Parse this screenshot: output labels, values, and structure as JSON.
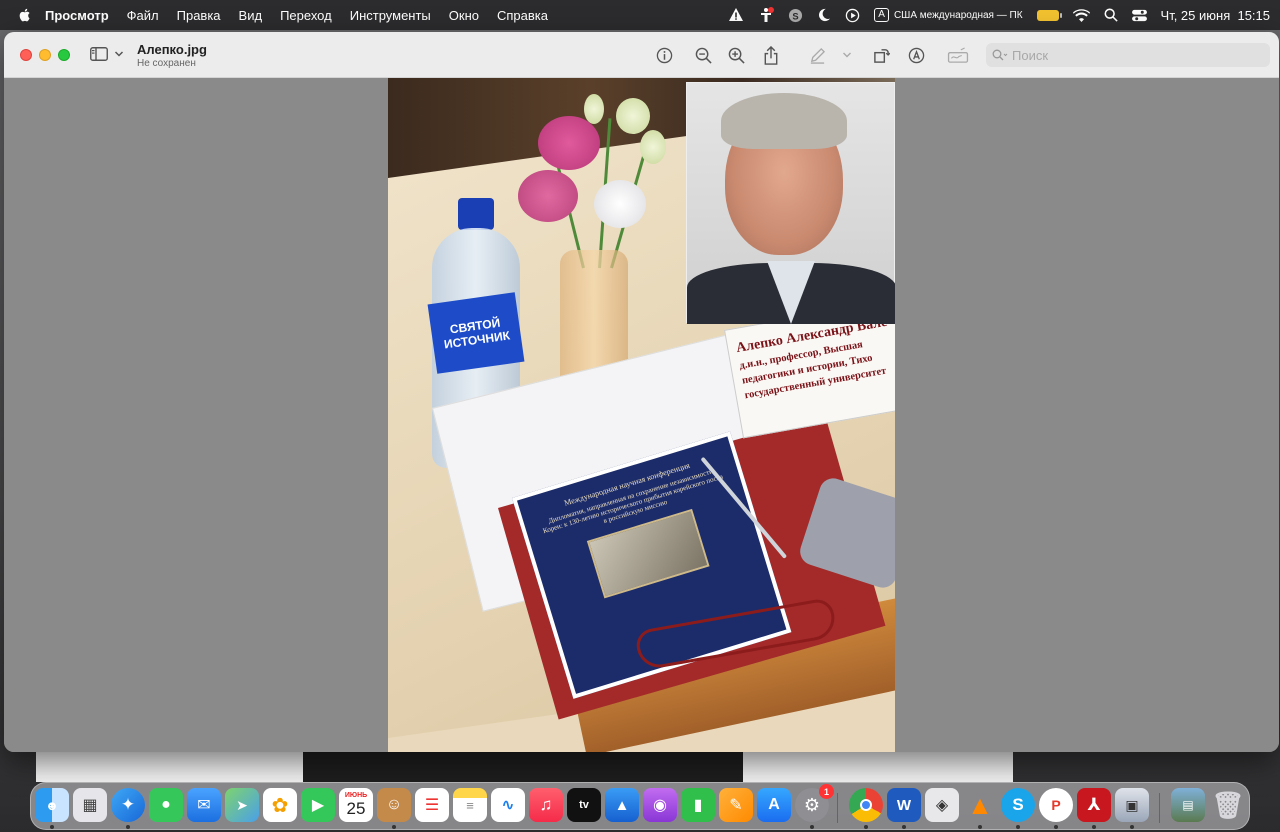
{
  "menubar": {
    "app_name": "Просмотр",
    "items": [
      "Файл",
      "Правка",
      "Вид",
      "Переход",
      "Инструменты",
      "Окно",
      "Справка"
    ],
    "input_source_key": "A",
    "input_source": "США международная — ПК",
    "datetime": "Чт, 25 июня  15:15",
    "icons": [
      "apple-icon",
      "warning-icon",
      "accessibility-icon",
      "skype-icon",
      "moon-icon",
      "play-icon",
      "battery-icon",
      "wifi-icon",
      "search-icon",
      "control-center-icon"
    ]
  },
  "window": {
    "title": "Алепко.jpg",
    "subtitle": "Не сохранен",
    "search_placeholder": "Поиск",
    "toolbar_icons": [
      "info-icon",
      "zoom-out-icon",
      "zoom-in-icon",
      "share-icon",
      "markup-pen-icon",
      "chevron-down-icon",
      "rotate-icon",
      "annotate-icon",
      "signature-icon"
    ]
  },
  "photo": {
    "bottle_label_line1": "СВЯТОЙ",
    "bottle_label_line2": "ИСТОЧНИК",
    "nameplate_line1": "Алепко Александр Вале",
    "nameplate_line2": "д.и.н., профессор, Высшая",
    "nameplate_line3": "педагогики и истории, Тихо",
    "nameplate_line4": "государственный университет",
    "booklet_title": "Международная научная конференция",
    "booklet_subtitle": "Дипломатия, направленная на сохранение независимости Кореи: к 130-летию исторического прибытия корейского посла в российскую миссию"
  },
  "dock": {
    "calendar_month": "ИЮНЬ",
    "calendar_day": "25",
    "badge_count": "1",
    "apps": [
      "finder",
      "launchpad",
      "safari",
      "messages",
      "mail",
      "maps",
      "photos",
      "facetime",
      "calendar",
      "contacts",
      "reminders",
      "notes",
      "freeform",
      "music",
      "tv",
      "keynote",
      "podcasts",
      "numbers",
      "pages",
      "app-store",
      "system-settings",
      "chrome",
      "word",
      "cyberduck",
      "vlc",
      "skype",
      "pdf-expert",
      "acrobat",
      "preview",
      "preview-image",
      "trash"
    ]
  }
}
